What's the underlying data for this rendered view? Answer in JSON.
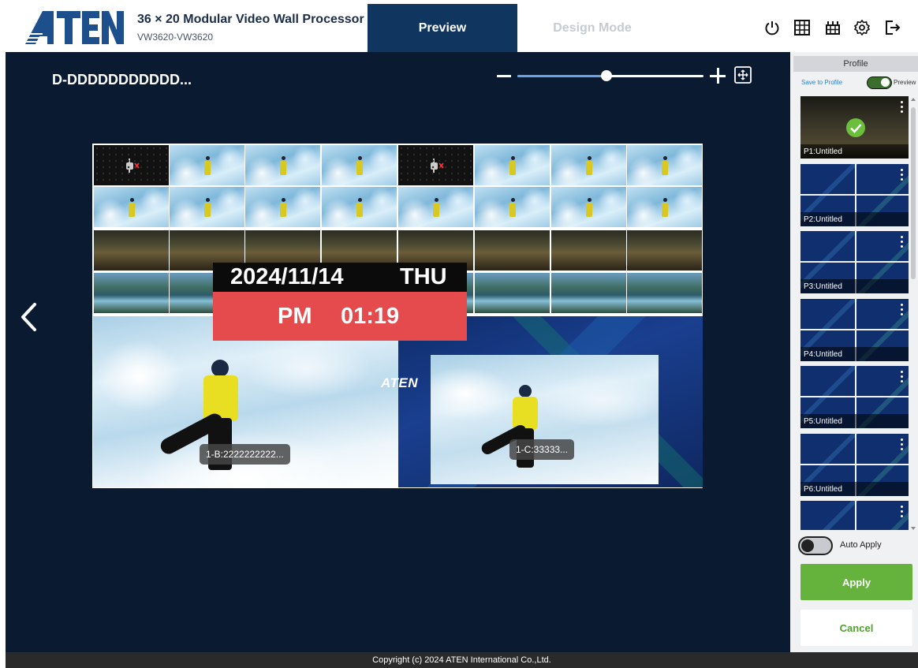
{
  "header": {
    "logo_text": "ATEN",
    "product_title": "36 × 20 Modular Video Wall Processor",
    "product_model": "VW3620-VW3620",
    "tabs": [
      {
        "label": "Preview",
        "active": true
      },
      {
        "label": "Design Mode",
        "active": false
      }
    ],
    "tools": [
      "power-icon",
      "grid-icon",
      "wall-icon",
      "settings-icon",
      "logout-icon"
    ]
  },
  "main": {
    "wall_name": "D-DDDDDDDDDDD...",
    "zoom_level": 0.48,
    "overlay": {
      "date": "2024/11/14",
      "weekday": "THU",
      "ampm": "PM",
      "time": "01:19"
    },
    "windows": [
      {
        "label": "1-B:2222222222..."
      },
      {
        "label": "1-C:33333..."
      }
    ],
    "watermark": "ATEN"
  },
  "panel": {
    "title": "Profile",
    "save_to_profile": "Save to Profile",
    "preview_label": "Preview",
    "preview_on": true,
    "profiles": [
      {
        "name": "P1:Untitled",
        "selected": true
      },
      {
        "name": "P2:Untitled",
        "selected": false
      },
      {
        "name": "P3:Untitled",
        "selected": false
      },
      {
        "name": "P4:Untitled",
        "selected": false
      },
      {
        "name": "P5:Untitled",
        "selected": false
      },
      {
        "name": "P6:Untitled",
        "selected": false
      },
      {
        "name": "",
        "selected": false
      }
    ],
    "auto_apply_label": "Auto Apply",
    "auto_apply_on": false,
    "apply_label": "Apply",
    "cancel_label": "Cancel"
  },
  "footer": {
    "copyright": "Copyright (c) 2024 ATEN International Co.,Ltd."
  },
  "colors": {
    "brand_navy": "#10355e",
    "canvas": "#0a1a30",
    "apply_green": "#65b33d",
    "time_red": "#e54a4c"
  }
}
